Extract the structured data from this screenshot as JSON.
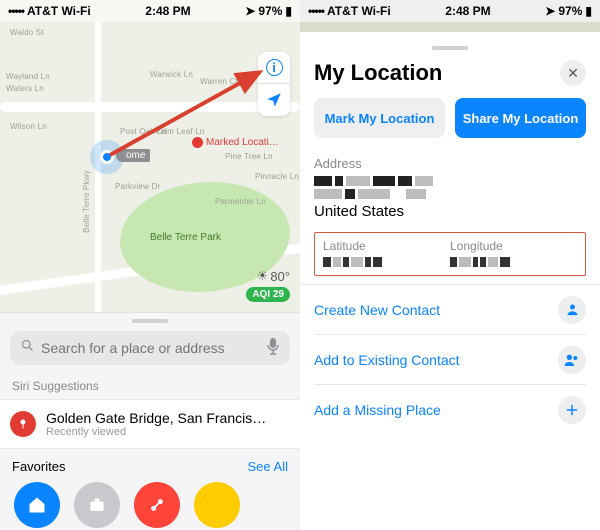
{
  "statusbar": {
    "carrier": "AT&T Wi-Fi",
    "time": "2:48 PM",
    "battery_pct": "97%"
  },
  "map": {
    "home_label": "ome",
    "marked_label": "Marked Locati…",
    "park_label": "Belle Terre Park",
    "temp": "80°",
    "aqi": "AQI 29",
    "streets": {
      "wayland": "Wayland Ln",
      "waters": "Waters Ln",
      "warwick": "Warwick Ln",
      "warren": "Warren Ct",
      "wilson": "Wilson Ln",
      "belle": "Belle Terre Pkwy",
      "post": "Post Oak Ln",
      "palm": "Palm Leaf Ln",
      "parkview": "Parkview Dr",
      "pinetree": "Pine Tree Ln",
      "pinnacle": "Pinnacle Ln",
      "parmenter": "Parmenter Ln",
      "waldo": "Waldo St"
    }
  },
  "sheet": {
    "search_placeholder": "Search for a place or address",
    "siri_label": "Siri Suggestions",
    "suggestion": {
      "title": "Golden Gate Bridge, San Francis…",
      "subtitle": "Recently viewed"
    },
    "favorites_label": "Favorites",
    "see_all": "See All"
  },
  "panel": {
    "title": "My Location",
    "mark_btn": "Mark My Location",
    "share_btn": "Share My Location",
    "address_label": "Address",
    "country": "United States",
    "lat_label": "Latitude",
    "lon_label": "Longitude",
    "actions": {
      "create": "Create New Contact",
      "add_existing": "Add to Existing Contact",
      "missing": "Add a Missing Place"
    }
  }
}
